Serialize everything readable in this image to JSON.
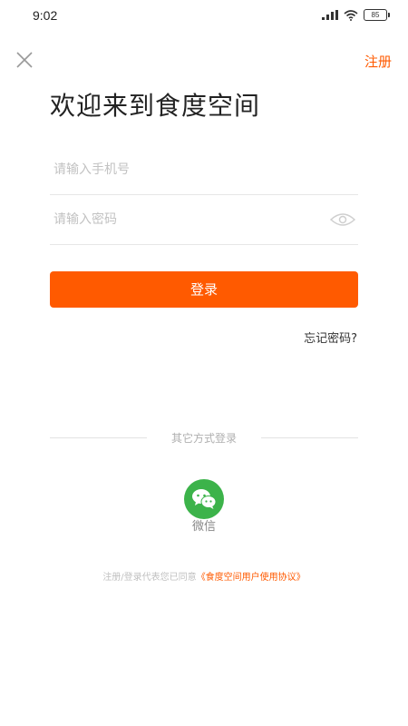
{
  "status_bar": {
    "time": "9:02",
    "battery": "85"
  },
  "header": {
    "close_icon": "close-icon",
    "register_label": "注册"
  },
  "title": "欢迎来到食度空间",
  "form": {
    "phone_placeholder": "请输入手机号",
    "phone_value": "",
    "password_placeholder": "请输入密码",
    "password_value": "",
    "password_toggle_icon": "eye-icon",
    "login_label": "登录",
    "forgot_label": "忘记密码?"
  },
  "other_login": {
    "divider_label": "其它方式登录",
    "wechat_icon": "wechat-icon",
    "wechat_label": "微信"
  },
  "agreement": {
    "prefix": "注册/登录代表您已同意",
    "link_text": "《食度空间用户使用协议》"
  },
  "colors": {
    "accent": "#ff5a00",
    "wechat_green": "#3cb34a"
  }
}
